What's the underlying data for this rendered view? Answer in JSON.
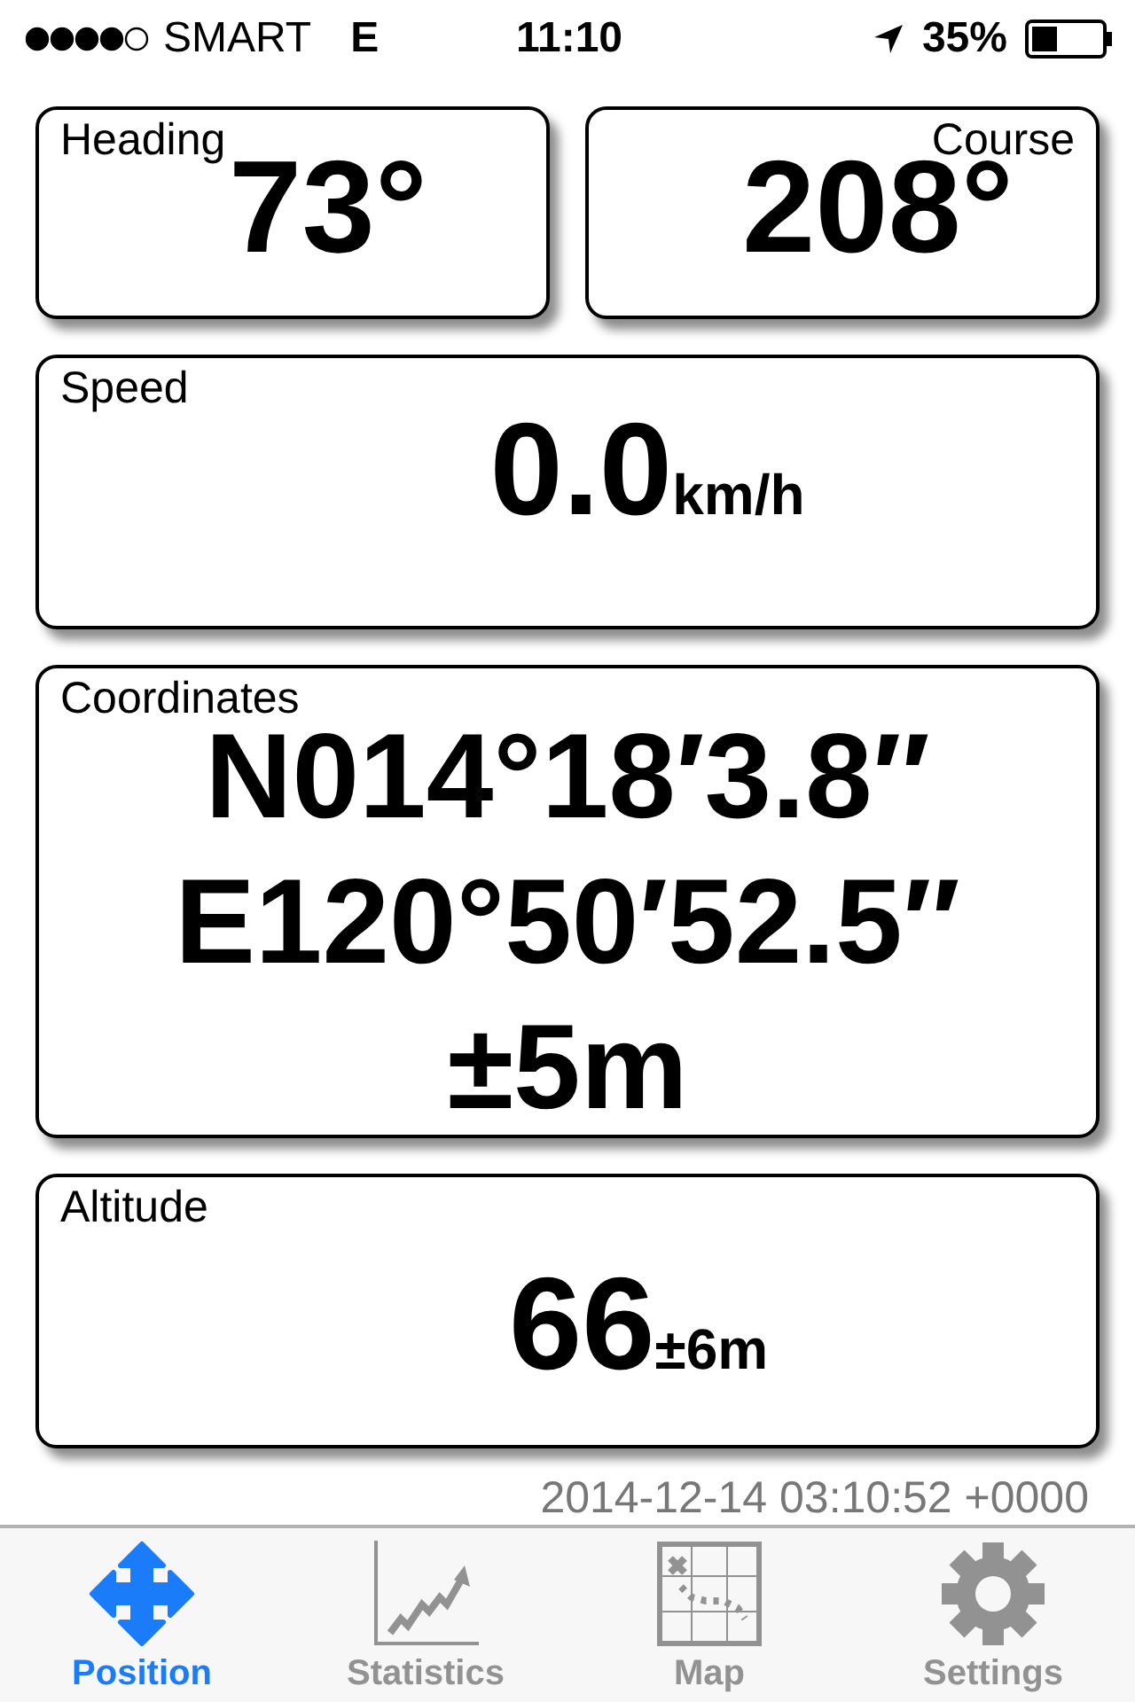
{
  "status_bar": {
    "carrier": "SMART",
    "network": "E",
    "time": "11:10",
    "battery_percent": "35%"
  },
  "top_cards": [
    {
      "label": "Heading",
      "value": "73°",
      "kind": "heading"
    },
    {
      "label": "Course",
      "value": "208°",
      "kind": "course"
    }
  ],
  "speed": {
    "label": "Speed",
    "value": "0.0",
    "unit": "km/h"
  },
  "coordinates": {
    "label": "Coordinates",
    "latitude": "N014°18′3.8″",
    "longitude": "E120°50′52.5″",
    "accuracy": "±5m"
  },
  "altitude": {
    "label": "Altitude",
    "value": "66",
    "accuracy": "±6m"
  },
  "timestamp": "2014-12-14 03:10:52 +0000",
  "tabs": [
    {
      "label": "Position",
      "kind": "position",
      "selected": true
    },
    {
      "label": "Statistics",
      "kind": "statistics",
      "selected": false
    },
    {
      "label": "Map",
      "kind": "map",
      "selected": false
    },
    {
      "label": "Settings",
      "kind": "settings",
      "selected": false
    }
  ]
}
